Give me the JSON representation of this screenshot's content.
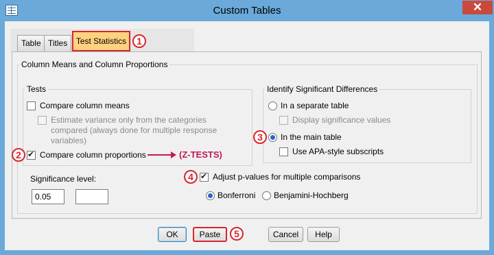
{
  "window": {
    "title": "Custom Tables",
    "close_glyph": "✕"
  },
  "tabs": [
    {
      "label": "Table"
    },
    {
      "label": "Titles"
    },
    {
      "label": "Test Statistics"
    }
  ],
  "callouts": [
    "1",
    "2",
    "3",
    "4",
    "5"
  ],
  "section": {
    "title": "Column Means and Column Proportions"
  },
  "tests": {
    "legend": "Tests",
    "compare_means": {
      "label": "Compare column means",
      "checked": false
    },
    "estimate_variance": {
      "label_line1": "Estimate variance only from the categories",
      "label_line2": "compared (always done for multiple response",
      "label_line3": "variables)",
      "enabled": false
    },
    "compare_props": {
      "label": "Compare column proportions",
      "checked": true
    },
    "annotation": "(Z-TESTS)"
  },
  "identify": {
    "legend": "Identify Significant Differences",
    "separate": {
      "label": "In a separate table",
      "selected": false
    },
    "display_sig": {
      "label": "Display significance values",
      "enabled": false
    },
    "main": {
      "label": "In the main table",
      "selected": true
    },
    "apa": {
      "label": "Use APA-style subscripts",
      "checked": false
    }
  },
  "significance": {
    "label": "Significance level:",
    "value": "0.05",
    "value2": ""
  },
  "adjust": {
    "label": "Adjust p-values for multiple comparisons",
    "checked": true
  },
  "methods": {
    "bonferroni": "Bonferroni",
    "bh": "Benjamini-Hochberg",
    "selected": "Bonferroni"
  },
  "buttons": {
    "ok": "OK",
    "paste": "Paste",
    "cancel": "Cancel",
    "help": "Help"
  },
  "colors": {
    "titlebar": "#6aa9d9",
    "callout": "#d6262c",
    "annotation": "#c2185b",
    "active_tab": "#ffd27f"
  }
}
